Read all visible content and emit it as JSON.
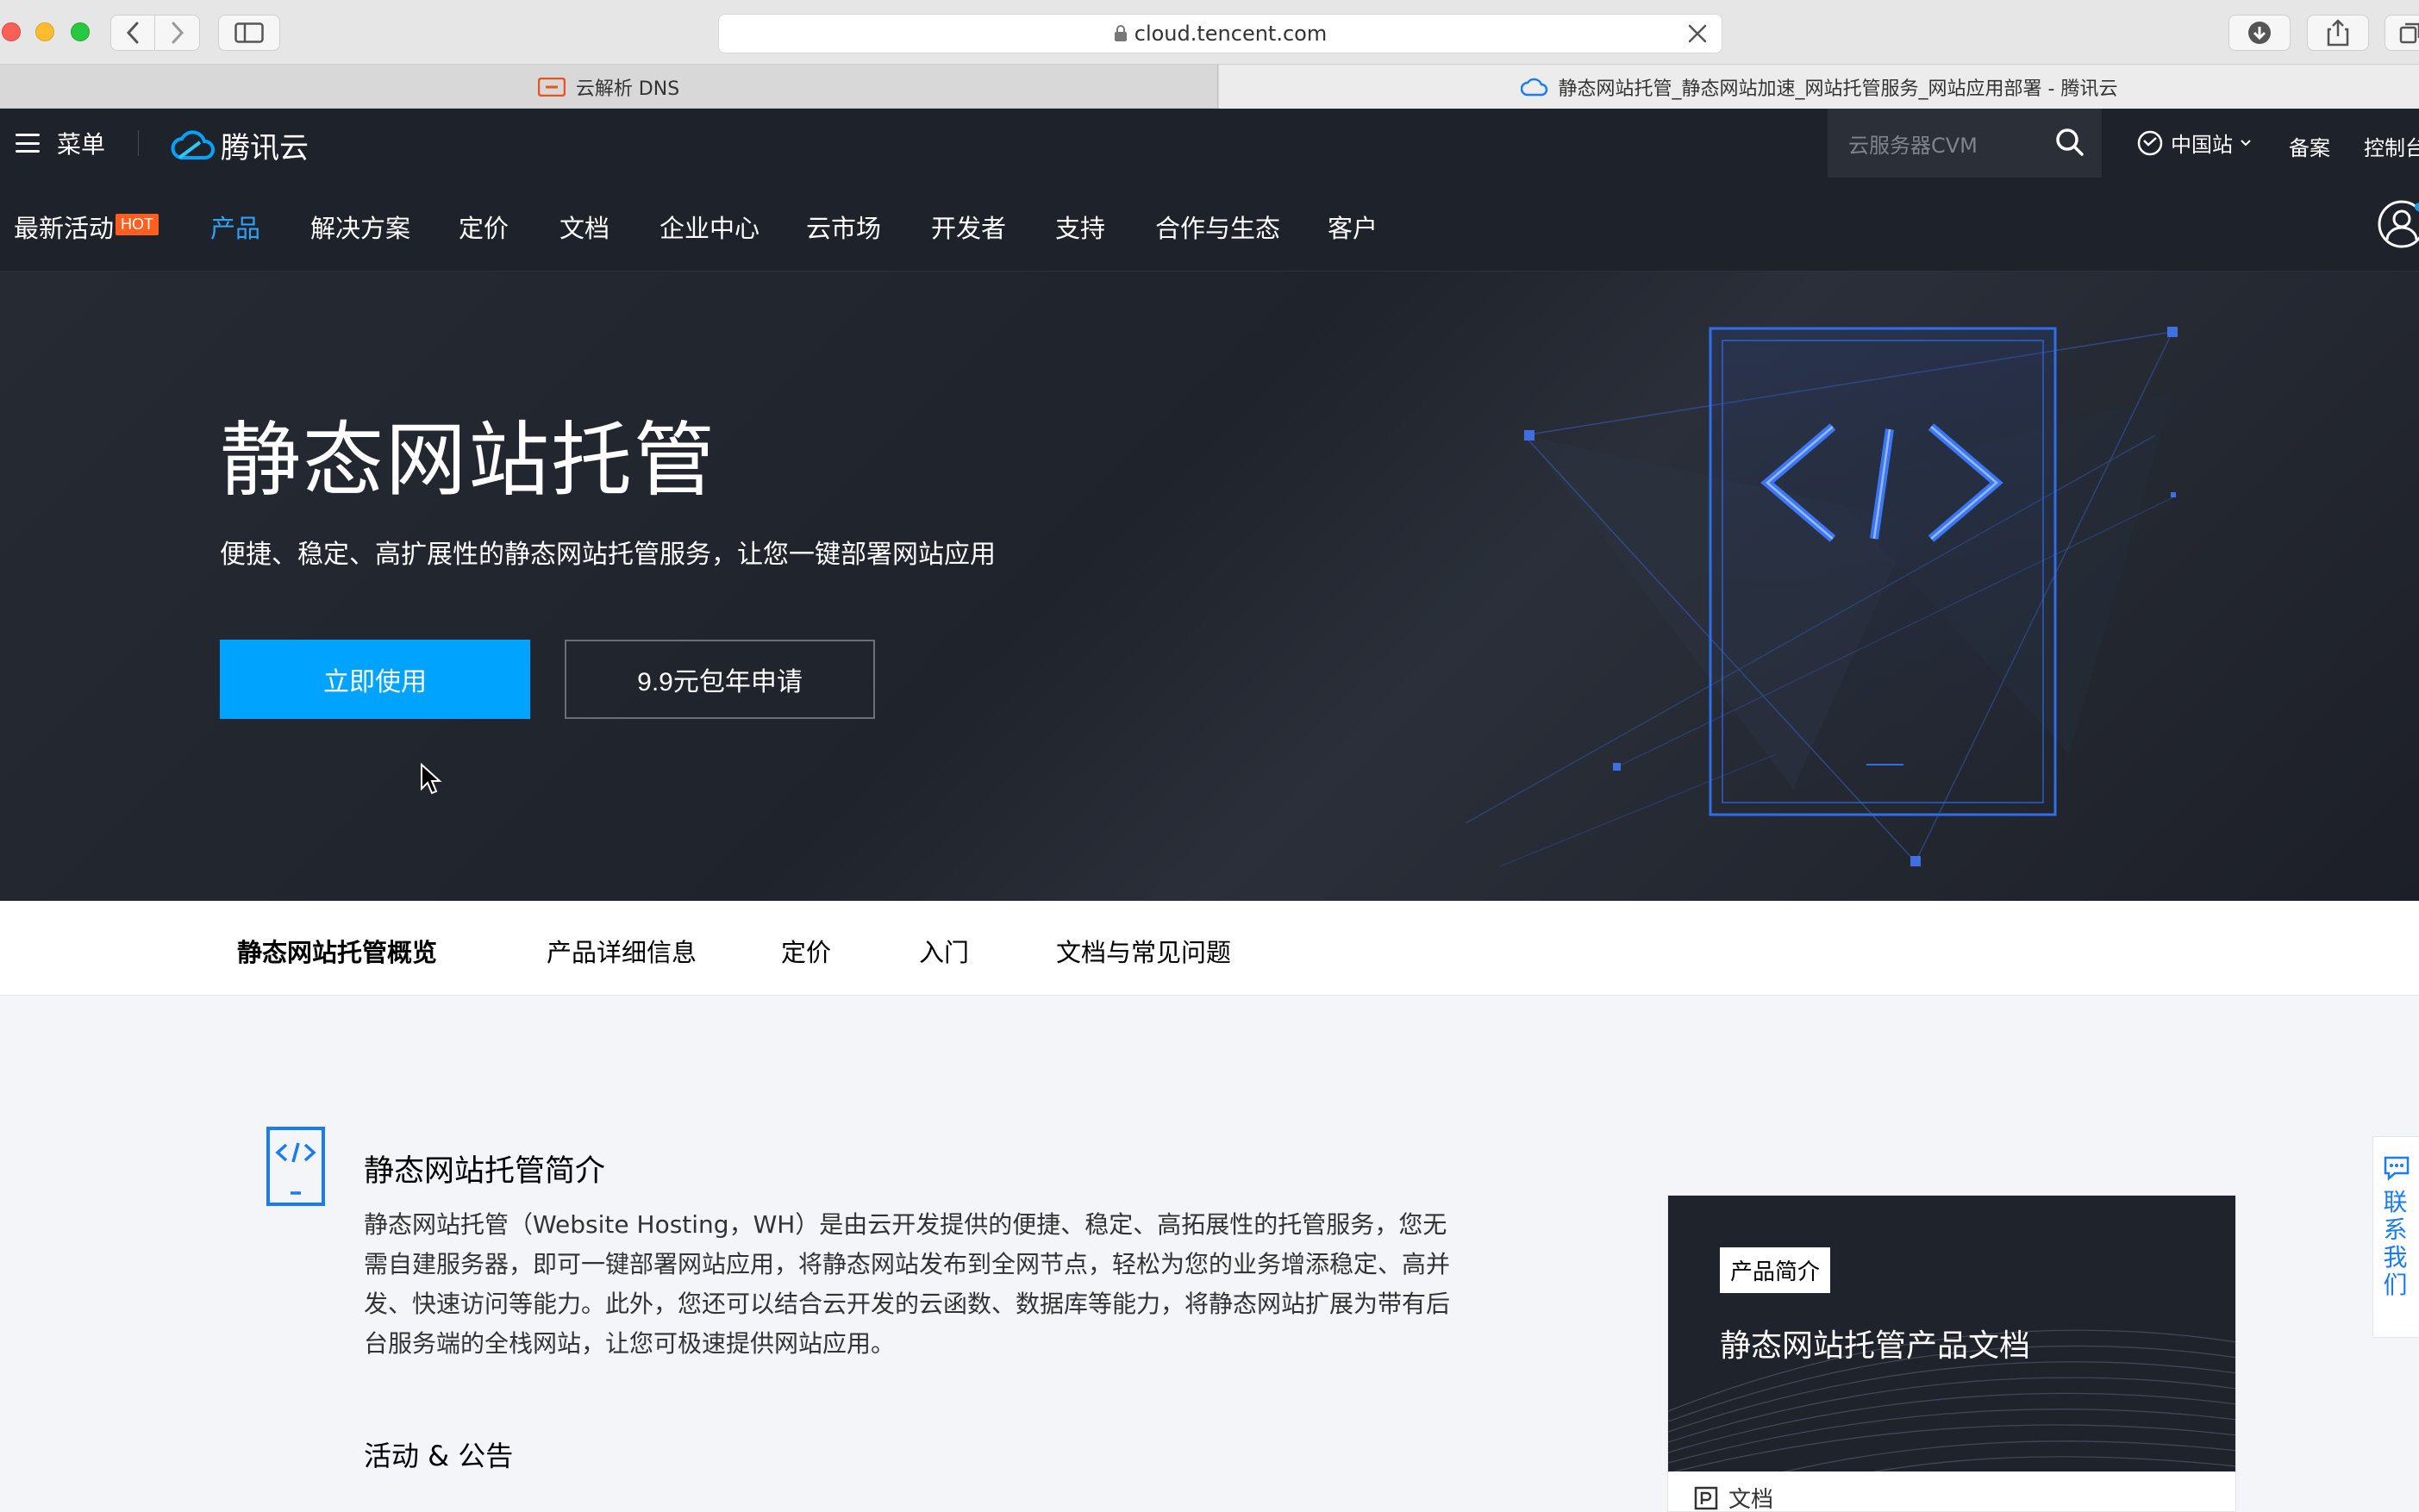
{
  "browser": {
    "url": "cloud.tencent.com",
    "tabs": [
      {
        "label": "云解析 DNS"
      },
      {
        "label": "静态网站托管_静态网站加速_网站托管服务_网站应用部署 - 腾讯云"
      }
    ]
  },
  "topnav": {
    "menu_label": "菜单",
    "logo_text": "腾讯云",
    "search_placeholder": "云服务器CVM",
    "region": "中国站",
    "beian": "备案",
    "console": "控制台"
  },
  "mainnav": {
    "items": [
      "最新活动",
      "产品",
      "解决方案",
      "定价",
      "文档",
      "企业中心",
      "云市场",
      "开发者",
      "支持",
      "合作与生态",
      "客户"
    ],
    "hot_badge": "HOT",
    "active_index": 1
  },
  "hero": {
    "title": "静态网站托管",
    "subtitle": "便捷、稳定、高扩展性的静态网站托管服务，让您一键部署网站应用",
    "primary_button": "立即使用",
    "secondary_button": "9.9元包年申请"
  },
  "subnav": {
    "items": [
      "静态网站托管概览",
      "产品详细信息",
      "定价",
      "入门",
      "文档与常见问题"
    ]
  },
  "intro": {
    "title": "静态网站托管简介",
    "body": "静态网站托管（Website Hosting，WH）是由云开发提供的便捷、稳定、高拓展性的托管服务，您无需自建服务器，即可一键部署网站应用，将静态网站发布到全网节点，轻松为您的业务增添稳定、高并发、快速访问等能力。此外，您还可以结合云开发的云函数、数据库等能力，将静态网站扩展为带有后台服务端的全栈网站，让您可极速提供网站应用。"
  },
  "activity": {
    "title": "活动 & 公告"
  },
  "doc_card": {
    "badge": "产品简介",
    "title": "静态网站托管产品文档",
    "footer": "文档"
  },
  "contact": {
    "label": "联系我们"
  },
  "colors": {
    "accent": "#00a4ff",
    "nav_bg": "#1e222a",
    "active_nav": "#2ea1f8",
    "hot": "#ff5e1f"
  }
}
